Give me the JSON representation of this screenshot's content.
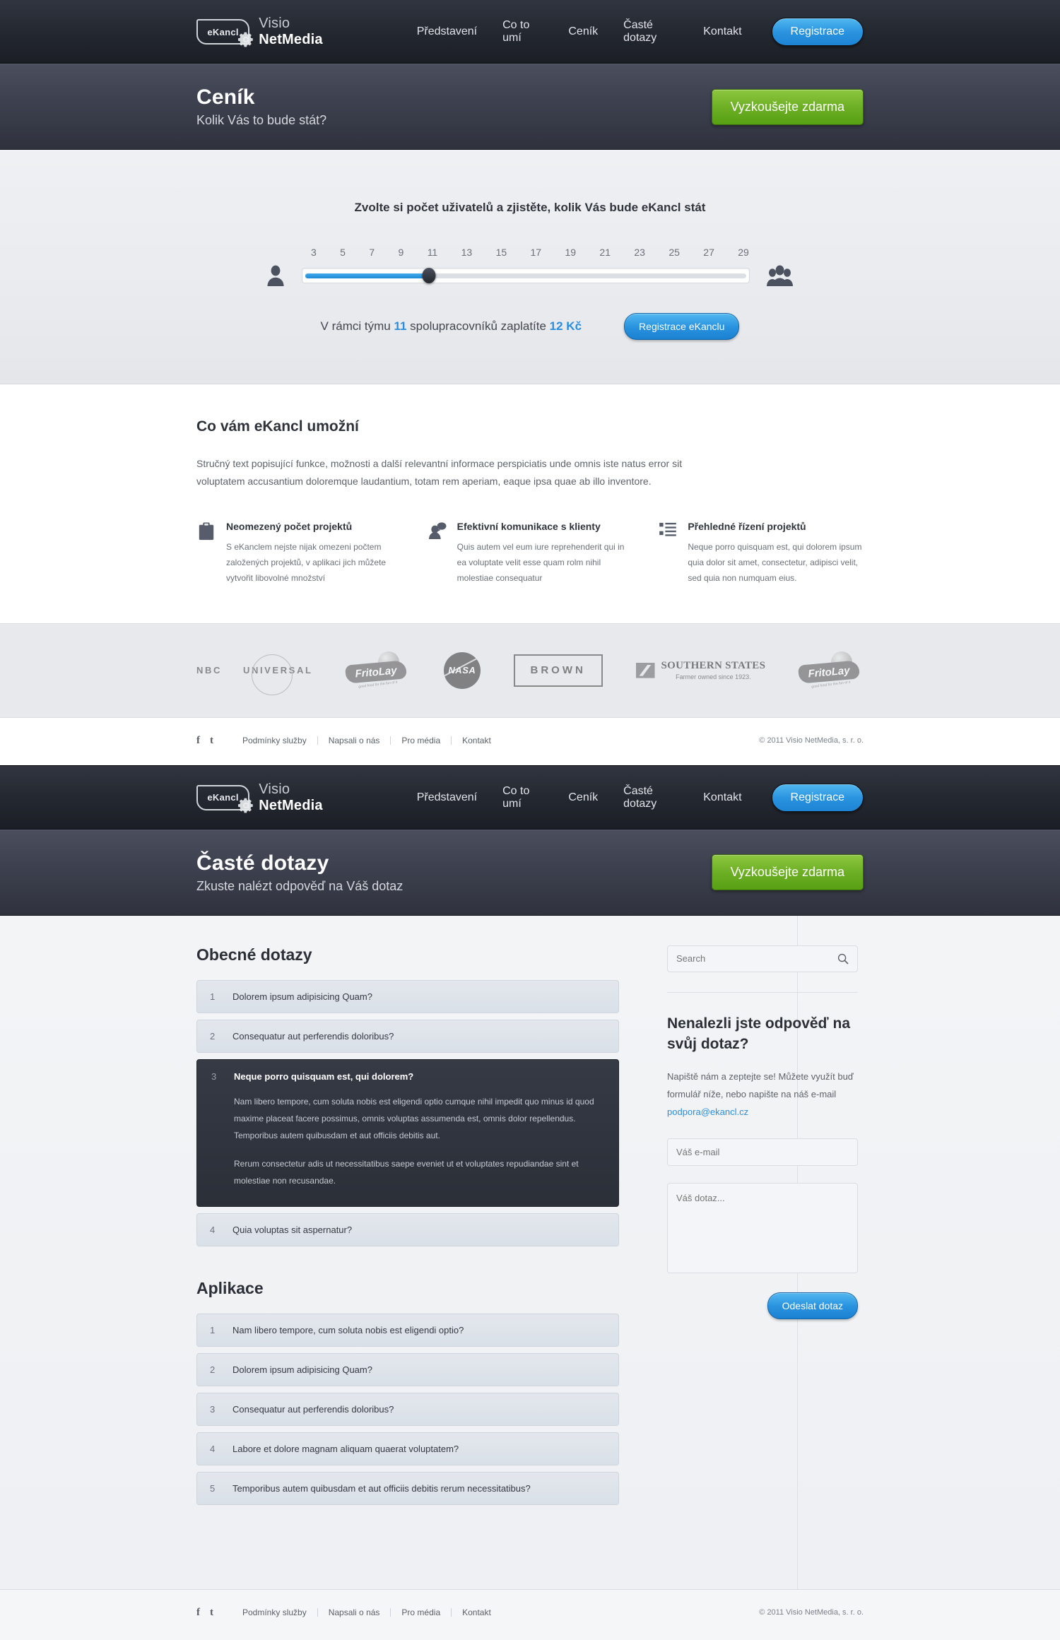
{
  "nav": {
    "logo_text": "eKancl",
    "brand_light": "Visio ",
    "brand_bold": "NetMedia",
    "links": [
      {
        "label": "Představení"
      },
      {
        "label": "Co to umí"
      },
      {
        "label": "Ceník"
      },
      {
        "label": "Časté dotazy"
      },
      {
        "label": "Kontakt"
      }
    ],
    "cta": "Registrace"
  },
  "banner_pricing": {
    "title": "Ceník",
    "subtitle": "Kolik Vás to bude stát?",
    "cta": "Vyzkoušejte zdarma"
  },
  "pricing": {
    "title": "Zvolte si počet uživatelů a zjistěte, kolik Vás bude eKancl stát",
    "ticks": [
      "3",
      "5",
      "7",
      "9",
      "11",
      "13",
      "15",
      "17",
      "19",
      "21",
      "23",
      "25",
      "27",
      "29"
    ],
    "selected_users": "11",
    "price": "12 Kč",
    "summary_prefix": "V rámci týmu ",
    "summary_mid": " spolupracovníků zaplatíte ",
    "cta": "Registrace eKanclu",
    "accent_color": "#2a8ede"
  },
  "features": {
    "heading": "Co vám eKancl umožní",
    "lead": "Stručný text popisující funkce, možnosti a další relevantní informace perspiciatis unde omnis iste natus error sit voluptatem accusantium doloremque laudantium, totam rem aperiam, eaque ipsa quae ab illo inventore.",
    "items": [
      {
        "icon": "clipboard-icon",
        "title": "Neomezený počet projektů",
        "text": "S eKanclem nejste nijak omezeni počtem založených projektů, v aplikaci jich můžete vytvořit libovolné množství"
      },
      {
        "icon": "speech-person-icon",
        "title": "Efektivní komunikace s klienty",
        "text": "Quis autem vel eum iure reprehenderit qui in ea voluptate velit esse quam  rolm nihil molestiae consequatur"
      },
      {
        "icon": "list-icon",
        "title": "Přehledné řízení projektů",
        "text": "Neque porro quisquam est, qui dolorem ipsum quia dolor sit amet, consectetur, adipisci velit, sed quia non numquam eius."
      }
    ]
  },
  "logos": [
    {
      "name": "NBC Universal",
      "parts": {
        "a": "NBC",
        "b": "UNIVERSAL"
      }
    },
    {
      "name": "Frito Lay",
      "parts": {
        "a": "FritoLay",
        "b": "good food for the fun of it"
      }
    },
    {
      "name": "NASA",
      "parts": {
        "a": "NASA",
        "b": ""
      }
    },
    {
      "name": "Brown",
      "parts": {
        "a": "BROWN",
        "b": ""
      }
    },
    {
      "name": "Southern States",
      "parts": {
        "a": "SOUTHERN STATES",
        "b": "Farmer owned since 1923."
      }
    },
    {
      "name": "Frito Lay",
      "parts": {
        "a": "FritoLay",
        "b": "good food for the fun of it"
      }
    }
  ],
  "footer": {
    "social": [
      {
        "icon": "facebook-icon",
        "glyph": "f"
      },
      {
        "icon": "twitter-icon",
        "glyph": "t"
      }
    ],
    "links": [
      "Podmínky služby",
      "Napsali o nás",
      "Pro média",
      "Kontakt"
    ],
    "copyright": "© 2011 Visio NetMedia, s. r. o."
  },
  "banner_faq": {
    "title": "Časté dotazy",
    "subtitle": "Zkuste nalézt odpověď na Váš dotaz",
    "cta": "Vyzkoušejte zdarma"
  },
  "faq": {
    "section1_title": "Obecné dotazy",
    "section1_items": [
      {
        "num": "1",
        "question": "Dolorem ipsum adipisicing Quam?",
        "open": false
      },
      {
        "num": "2",
        "question": "Consequatur aut perferendis doloribus?",
        "open": false
      },
      {
        "num": "3",
        "question": "Neque porro quisquam est, qui dolorem?",
        "open": true,
        "answer_p1": "Nam libero tempore, cum soluta nobis est eligendi optio cumque nihil impedit quo minus id quod maxime placeat facere possimus, omnis voluptas assumenda est, omnis dolor repellendus. Temporibus autem quibusdam et aut officiis debitis aut.",
        "answer_p2": "Rerum consectetur adis ut necessitatibus saepe eveniet ut et voluptates repudiandae sint et molestiae non recusandae."
      },
      {
        "num": "4",
        "question": "Quia voluptas sit aspernatur?",
        "open": false
      }
    ],
    "section2_title": "Aplikace",
    "section2_items": [
      {
        "num": "1",
        "question": "Nam libero tempore, cum soluta nobis est eligendi optio?"
      },
      {
        "num": "2",
        "question": "Dolorem ipsum adipisicing Quam?"
      },
      {
        "num": "3",
        "question": "Consequatur aut perferendis doloribus?"
      },
      {
        "num": "4",
        "question": "Labore et dolore magnam aliquam quaerat voluptatem?"
      },
      {
        "num": "5",
        "question": "Temporibus autem quibusdam et aut officiis debitis rerum necessitatibus?"
      }
    ]
  },
  "sidebar": {
    "search_placeholder": "Search",
    "search_value": "",
    "heading": "Nenalezli jste odpověď na svůj dotaz?",
    "info_before": "Napiště nám a zeptejte se! Můžete využít buď formulář níže, nebo napište na náš e-mail ",
    "info_email": "podpora@ekancl.cz",
    "email_placeholder": "Váš e-mail",
    "message_placeholder": "Váš dotaz...",
    "submit_label": "Odeslat dotaz"
  }
}
